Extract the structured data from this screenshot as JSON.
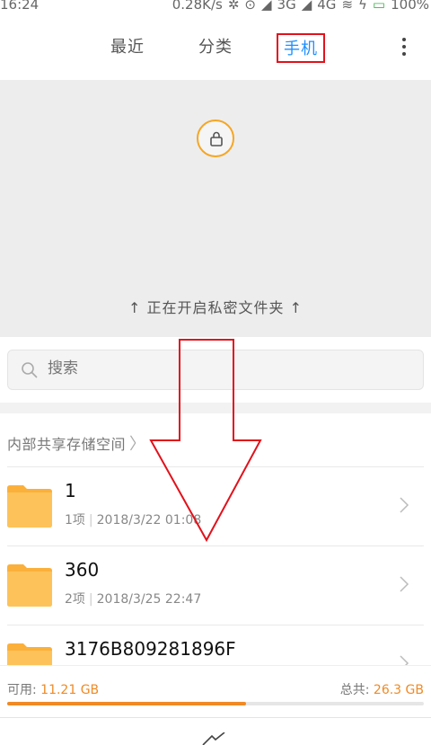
{
  "status_bar": {
    "time": "16:24",
    "speed": "0.28K/s",
    "network_3g": "3G",
    "network_4g": "4G",
    "battery": "100%"
  },
  "tabs": {
    "recent": "最近",
    "category": "分类",
    "phone": "手机"
  },
  "private_folder": {
    "hint": "↑ 正在开启私密文件夹 ↑"
  },
  "search": {
    "placeholder": "搜索"
  },
  "breadcrumb": {
    "label": "内部共享存储空间"
  },
  "files": [
    {
      "name": "1",
      "count": "1项",
      "date": "2018/3/22 01:08"
    },
    {
      "name": "360",
      "count": "2项",
      "date": "2018/3/25 22:47"
    },
    {
      "name": "3176B809281896F",
      "count": "",
      "date": ""
    }
  ],
  "storage": {
    "available_label": "可用:",
    "available_value": "11.21 GB",
    "total_label": "总共:",
    "total_value": "26.3 GB",
    "used_fraction": 0.574
  },
  "colors": {
    "accent_blue": "#1e90ff",
    "orange": "#f08a24",
    "highlight_red": "#e1121b",
    "folder": "#fbb03b"
  }
}
